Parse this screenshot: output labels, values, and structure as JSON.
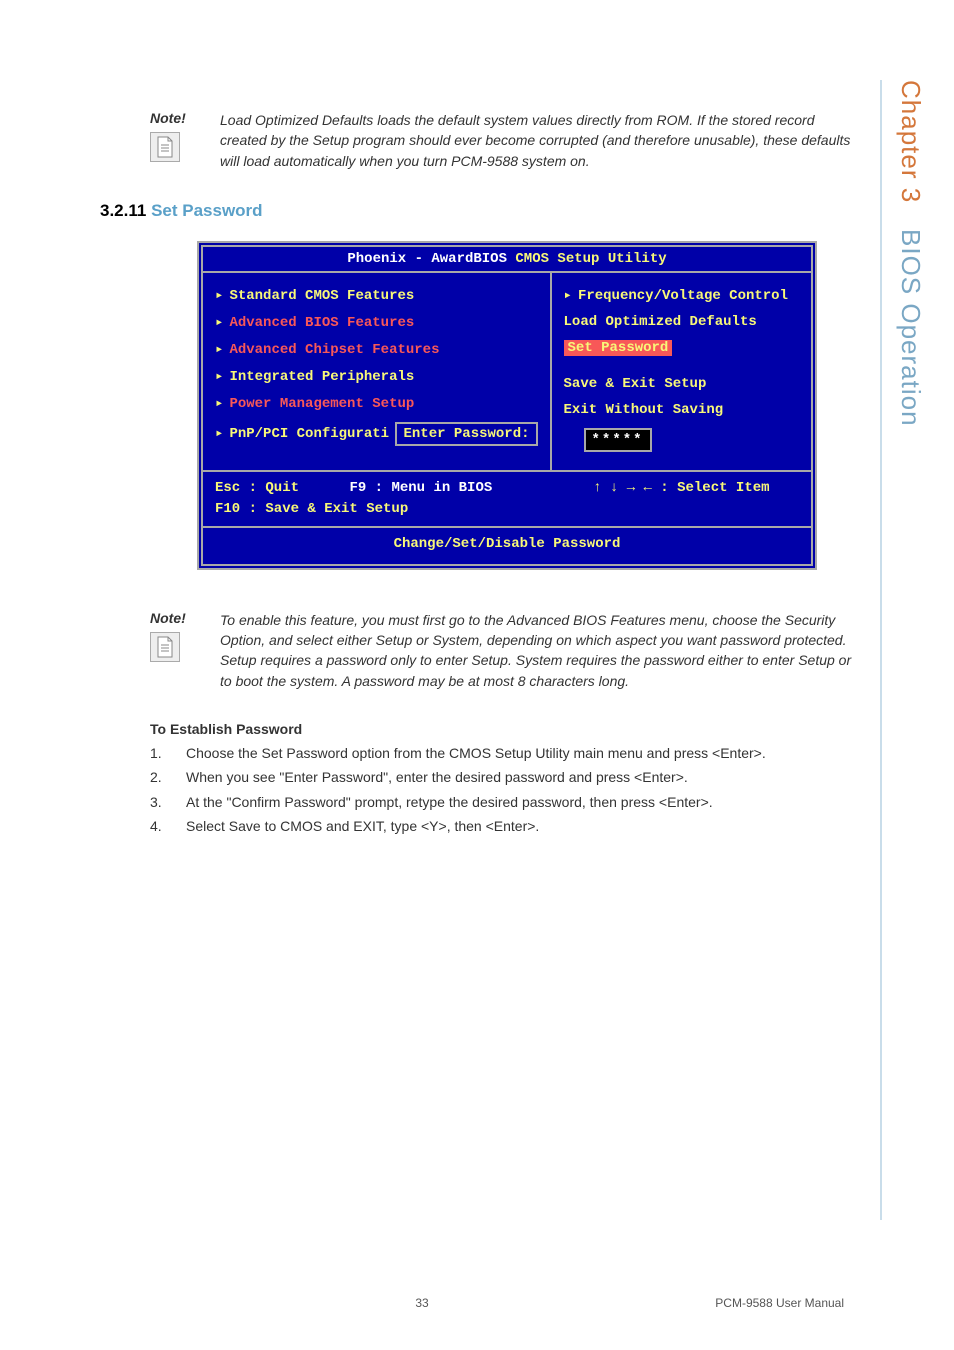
{
  "sideTab": {
    "chapter": "Chapter 3",
    "section": "BIOS Operation"
  },
  "note1": {
    "label": "Note!",
    "text": "Load Optimized Defaults loads the default system values directly from ROM. If the stored record created by the Setup program should ever become corrupted (and therefore unusable), these defaults will load automatically when you turn PCM-9588 system on."
  },
  "heading": {
    "num": "3.2.11",
    "title": "Set Password"
  },
  "bios": {
    "titleA": "Phoenix - AwardBIOS",
    "titleB": "CMOS Setup Utility",
    "left": {
      "i1": "Standard CMOS Features",
      "i2": "Advanced BIOS Features",
      "i3": "Advanced Chipset Features",
      "i4": "Integrated Peripherals",
      "i5": "Power Management Setup",
      "i6": "PnP/PCI Configurati"
    },
    "pwPrompt": "Enter Password:",
    "pwMask": "*****",
    "right": {
      "i1": "Frequency/Voltage Control",
      "i2": "Load Optimized Defaults",
      "i3": "Set Password",
      "i4": "Save & Exit Setup",
      "i5": "Exit Without Saving"
    },
    "help1a": "Esc : Quit",
    "help1b": "F9 : Menu in BIOS",
    "help1c": "↑ ↓ → ←   : Select Item",
    "help2": "F10 : Save & Exit Setup",
    "footer": "Change/Set/Disable Password"
  },
  "note2": {
    "label": "Note!",
    "text": "To enable this feature, you must first go to the Advanced BIOS Features menu, choose the Security Option, and select either Setup or System, depending on which aspect you want password protected. Setup requires a password only to enter Setup. System requires the password either to enter Setup or to boot the system. A password may be at most 8 characters long."
  },
  "establish": {
    "heading": "To Establish Password",
    "s1": "Choose the Set Password option from the CMOS Setup Utility main menu and press <Enter>.",
    "s2": "When you see \"Enter Password\", enter the desired password and press <Enter>.",
    "s3": "At the \"Confirm Password\" prompt, retype the desired password, then press <Enter>.",
    "s4": "Select Save to CMOS and EXIT, type <Y>, then <Enter>."
  },
  "footer": {
    "page": "33",
    "doc": "PCM-9588 User Manual"
  }
}
